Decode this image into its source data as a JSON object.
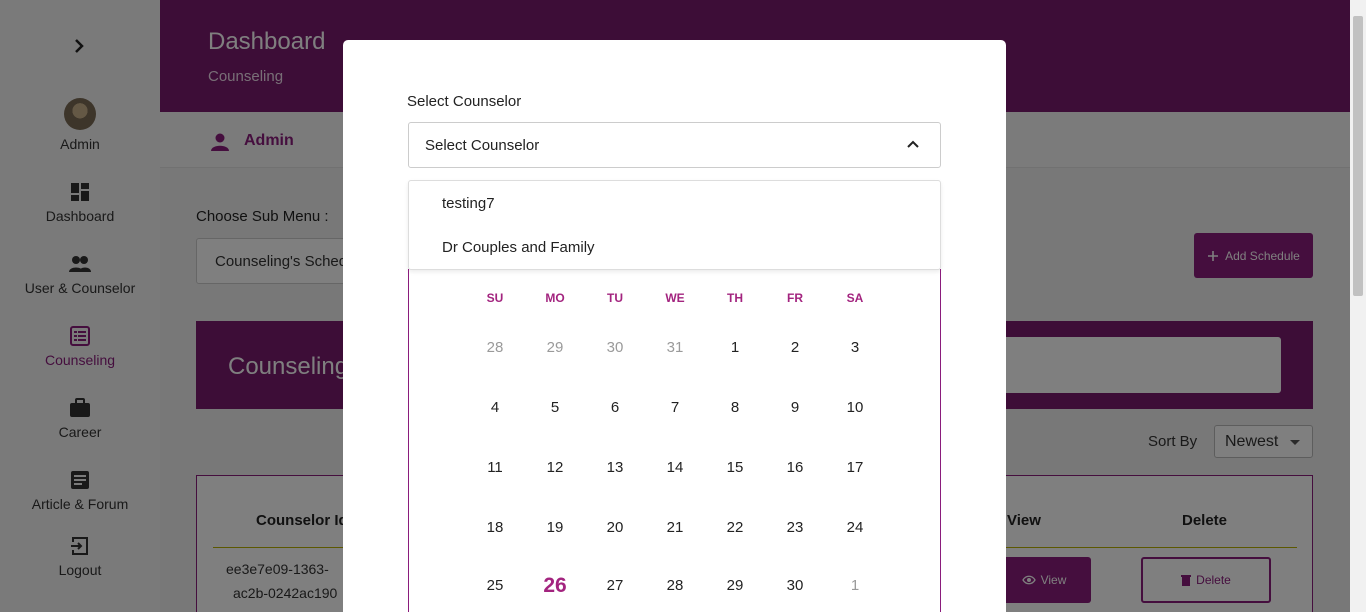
{
  "sidebar": {
    "items": [
      {
        "label": "Admin",
        "icon": "avatar"
      },
      {
        "label": "Dashboard",
        "icon": "dashboard-icon"
      },
      {
        "label": "User & Counselor",
        "icon": "people-icon"
      },
      {
        "label": "Counseling",
        "icon": "list-icon"
      },
      {
        "label": "Career",
        "icon": "briefcase-icon"
      },
      {
        "label": "Article & Forum",
        "icon": "article-icon"
      },
      {
        "label": "Logout",
        "icon": "logout-icon"
      }
    ]
  },
  "header": {
    "title": "Dashboard",
    "subtitle": "Counseling"
  },
  "userbar": {
    "name": "Admin"
  },
  "submenu": {
    "label": "Choose Sub Menu :",
    "value": "Counseling's Schedule"
  },
  "actions": {
    "add_schedule": "Add Schedule"
  },
  "banner": {
    "title": "Counseling Schedule"
  },
  "sort": {
    "label": "Sort By",
    "value": "Newest"
  },
  "table": {
    "headers": {
      "counselor_id": "Counselor Id",
      "view": "View",
      "delete": "Delete"
    },
    "row": {
      "id_line1": "ee3e7e09-1363-",
      "id_line2": "ac2b-0242ac190",
      "view_label": "View",
      "delete_label": "Delete"
    }
  },
  "modal": {
    "field_label": "Select Counselor",
    "select_value": "Select Counselor",
    "options": [
      "testing7",
      "Dr Couples and Family"
    ],
    "calendar": {
      "weekdays": [
        "SU",
        "MO",
        "TU",
        "WE",
        "TH",
        "FR",
        "SA"
      ],
      "weeks": [
        [
          "28",
          "29",
          "30",
          "31",
          "1",
          "2",
          "3"
        ],
        [
          "4",
          "5",
          "6",
          "7",
          "8",
          "9",
          "10"
        ],
        [
          "11",
          "12",
          "13",
          "14",
          "15",
          "16",
          "17"
        ],
        [
          "18",
          "19",
          "20",
          "21",
          "22",
          "23",
          "24"
        ],
        [
          "25",
          "26",
          "27",
          "28",
          "29",
          "30",
          "1"
        ]
      ],
      "muted_days": [
        [
          0,
          0
        ],
        [
          0,
          1
        ],
        [
          0,
          2
        ],
        [
          0,
          3
        ],
        [
          4,
          6
        ]
      ],
      "today": [
        4,
        1
      ]
    }
  },
  "colors": {
    "accent": "#8a1c7c",
    "header": "#7a1a6f",
    "weekday": "#a3247f"
  }
}
